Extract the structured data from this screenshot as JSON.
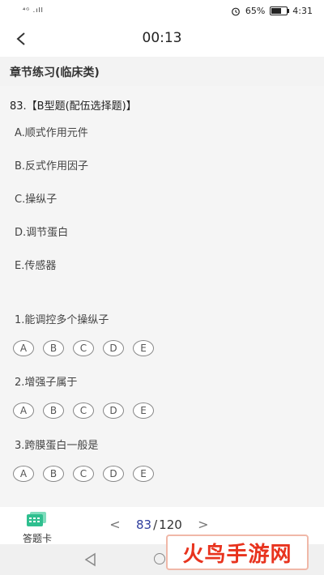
{
  "status_bar": {
    "signal": "⁴ᴳ .ıll",
    "battery_percent": "65%",
    "battery_level": 0.65,
    "time": "4:31"
  },
  "nav": {
    "title": "00:13"
  },
  "section": {
    "title": "章节练习(临床类)"
  },
  "question": {
    "header": "83.【B型题(配伍选择题)】",
    "options": [
      "A.顺式作用元件",
      "B.反式作用因子",
      "C.操纵子",
      "D.调节蛋白",
      "E.传感器"
    ],
    "sub_questions": [
      {
        "text": "1.能调控多个操纵子",
        "choices": [
          "A",
          "B",
          "C",
          "D",
          "E"
        ]
      },
      {
        "text": "2.增强子属于",
        "choices": [
          "A",
          "B",
          "C",
          "D",
          "E"
        ]
      },
      {
        "text": "3.跨膜蛋白一般是",
        "choices": [
          "A",
          "B",
          "C",
          "D",
          "E"
        ]
      }
    ]
  },
  "footer": {
    "card_label": "答题卡",
    "current": "83",
    "separator": "/",
    "total": "120",
    "prev": "<",
    "next": ">"
  },
  "watermark": {
    "text": "火鸟手游网"
  },
  "colors": {
    "accent": "#2f3e9e",
    "card_icon": "#2fbf8f",
    "watermark": "#e8331e"
  }
}
